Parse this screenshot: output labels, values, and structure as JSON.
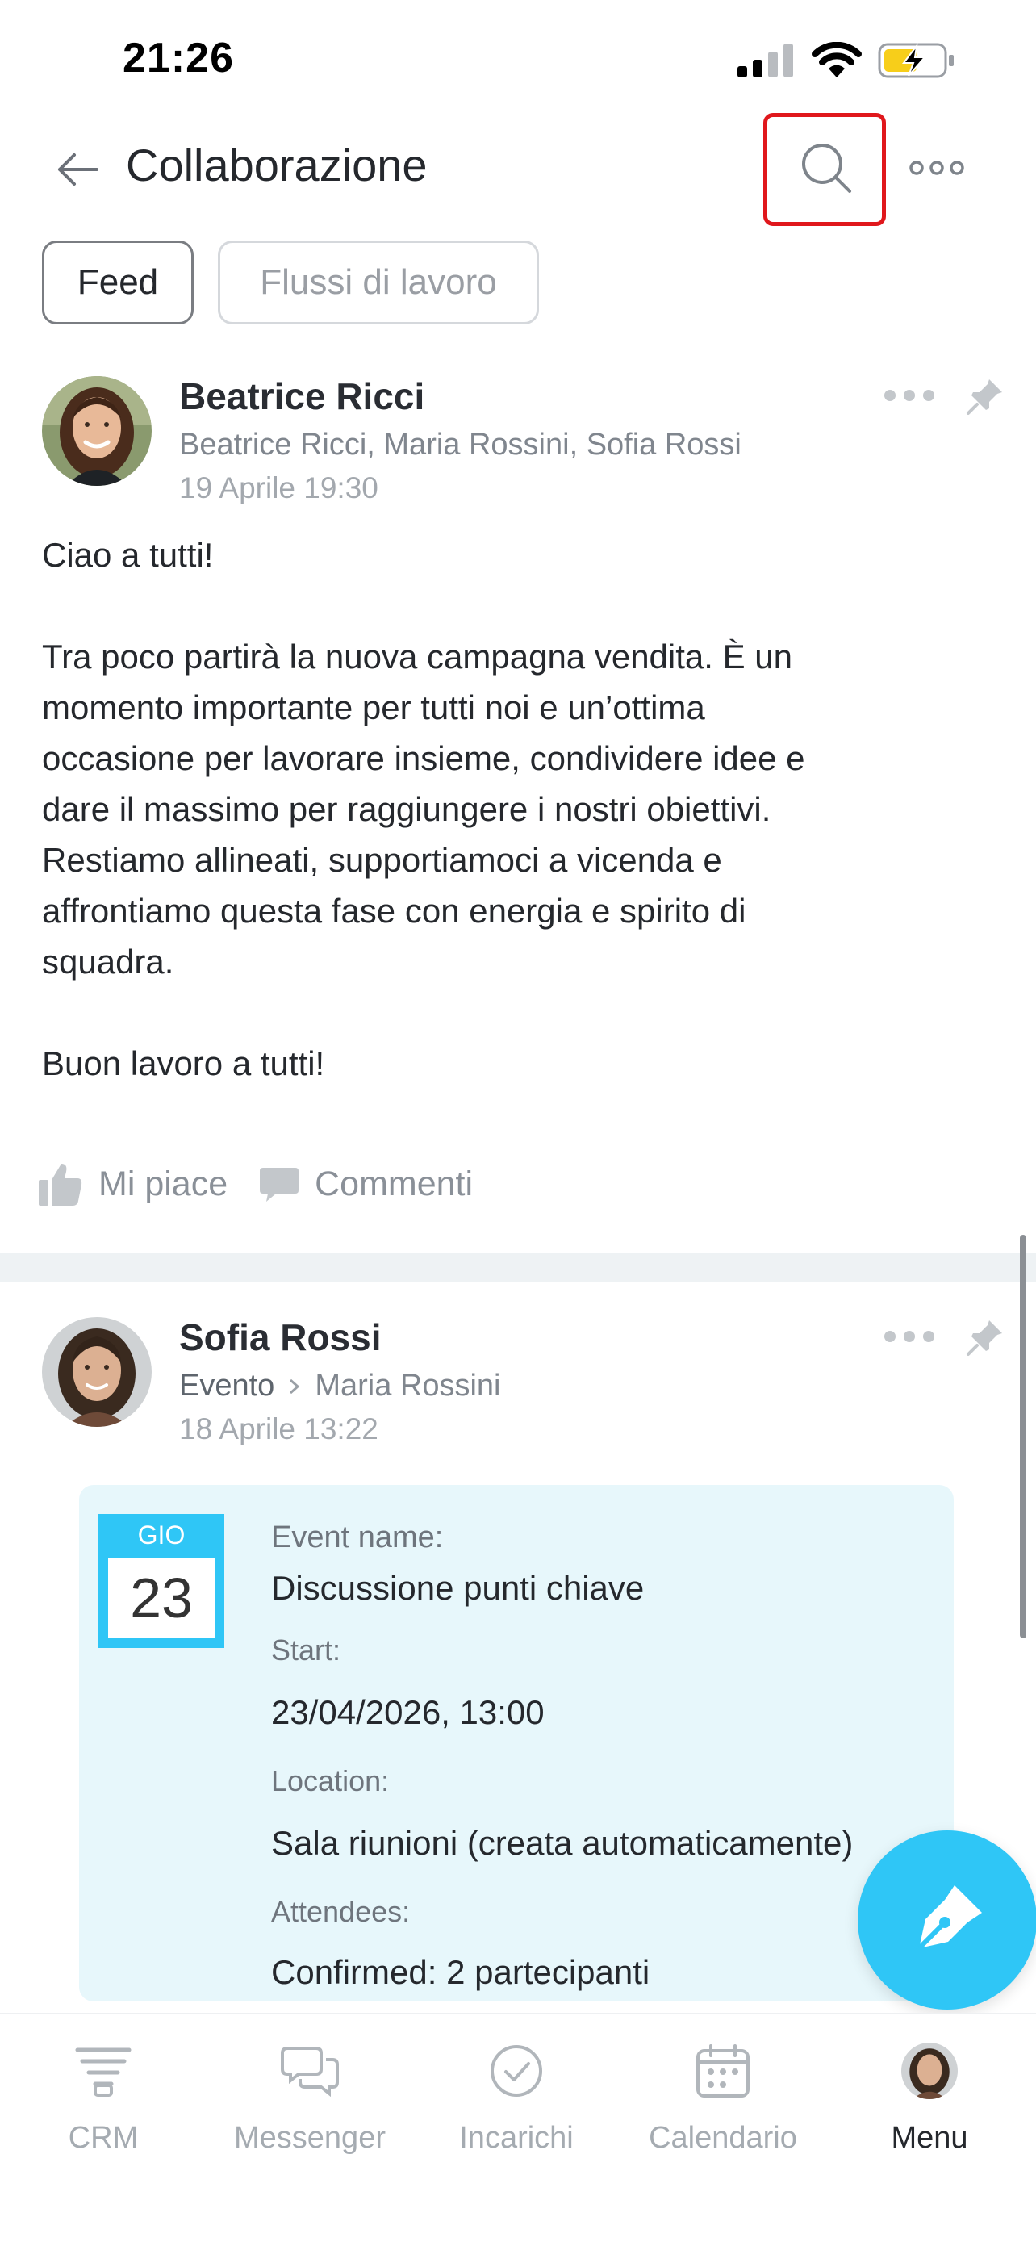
{
  "status_bar": {
    "time": "21:26"
  },
  "header": {
    "title": "Collaborazione"
  },
  "tabs": [
    {
      "label": "Feed",
      "active": true
    },
    {
      "label": "Flussi di lavoro",
      "active": false
    }
  ],
  "posts": [
    {
      "author": "Beatrice Ricci",
      "recipients": "Beatrice Ricci, Maria Rossini, Sofia Rossi",
      "date": "19 Aprile 19:30",
      "body": "Ciao a tutti!\n\nTra poco partirà la nuova campagna vendita. È un\nmomento importante per tutti noi e un’ottima\noccasione per lavorare insieme, condividere idee e\ndare il massimo per raggiungere i nostri obiettivi.\nRestiamo allineati, supportiamoci a vicenda e\naffrontiamo questa fase con energia e spirito di\nsquadra.\n\nBuon lavoro a tutti!",
      "like_label": "Mi piace",
      "comment_label": "Commenti"
    },
    {
      "author": "Sofia Rossi",
      "type": "Evento",
      "recipient": "Maria Rossini",
      "date": "18 Aprile 13:22",
      "event": {
        "day": "GIO",
        "date": "23",
        "name_label": "Event name:",
        "name": "Discussione punti chiave",
        "start_label": "Start:",
        "start": "23/04/2026, 13:00",
        "location_label": "Location:",
        "location": "Sala riunioni (creata automaticamente)",
        "attendees_label": "Attendees:",
        "attendees": "Confirmed: 2 partecipanti"
      }
    }
  ],
  "bottom_nav": [
    {
      "label": "CRM",
      "icon": "crm-icon"
    },
    {
      "label": "Messenger",
      "icon": "chat-icon"
    },
    {
      "label": "Incarichi",
      "icon": "check-circle-icon"
    },
    {
      "label": "Calendario",
      "icon": "calendar-icon"
    },
    {
      "label": "Menu",
      "icon": "avatar",
      "active": true
    }
  ],
  "colors": {
    "accent": "#2fc6f6",
    "highlight": "#e0171c",
    "event_bg": "#e7f7fb"
  }
}
